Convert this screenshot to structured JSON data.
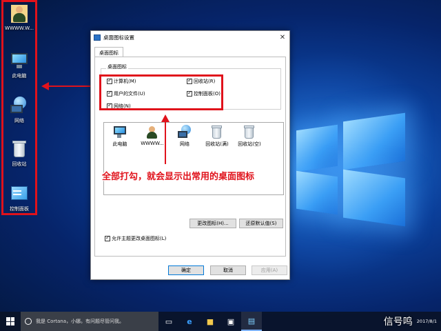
{
  "desktop": {
    "icons": [
      {
        "label": "WWWW.W...",
        "icon": "user-folder-icon"
      },
      {
        "label": "此电脑",
        "icon": "computer-icon"
      },
      {
        "label": "网络",
        "icon": "network-icon"
      },
      {
        "label": "回收站",
        "icon": "recycle-bin-icon"
      },
      {
        "label": "控制面板",
        "icon": "control-panel-icon"
      }
    ]
  },
  "dialog": {
    "title": "桌面图标设置",
    "close": "✕",
    "tab": "桌面图标",
    "group_title": "桌面图标",
    "checkboxes": [
      {
        "label": "计算机(M)",
        "checked": true
      },
      {
        "label": "回收站(R)",
        "checked": true
      },
      {
        "label": "用户的文件(U)",
        "checked": true
      },
      {
        "label": "控制面板(O)",
        "checked": true
      },
      {
        "label": "网络(N)",
        "checked": true
      }
    ],
    "icon_list": [
      {
        "label": "此电脑",
        "icon": "computer-icon"
      },
      {
        "label": "WWWW...",
        "icon": "user-folder-icon"
      },
      {
        "label": "网络",
        "icon": "network-icon"
      },
      {
        "label": "回收站(满)",
        "icon": "recycle-bin-full-icon"
      },
      {
        "label": "回收站(空)",
        "icon": "recycle-bin-empty-icon"
      }
    ],
    "change_icon_button": "更改图标(H)...",
    "restore_default_button": "还原默认值(S)",
    "allow_themes_label": "允许主题更改桌面图标(L)",
    "ok_button": "确定",
    "cancel_button": "取消",
    "apply_button": "应用(A)"
  },
  "annotation": {
    "caption": "全部打勾，就会显示出常用的桌面图标",
    "color": "#e0121b"
  },
  "taskbar": {
    "search_placeholder": "我是 Cortana，小娜。有问题尽管问我。",
    "watermark": "信号鸣",
    "clock_top": "",
    "clock_date": "2017/8/1"
  }
}
